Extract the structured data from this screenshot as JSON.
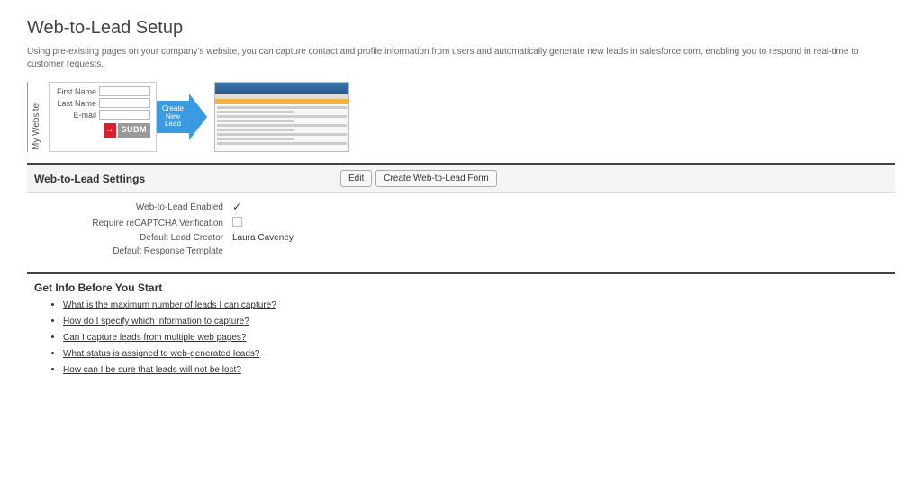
{
  "page": {
    "title": "Web-to-Lead Setup",
    "description": "Using pre-existing pages on your company's website, you can capture contact and profile information from users and automatically generate new leads in salesforce.com, enabling you to respond in real-time to customer requests."
  },
  "illustration": {
    "sidelabel": "My Website",
    "fields": {
      "firstname": "First Name",
      "lastname": "Last Name",
      "email": "E-mail"
    },
    "submit": "SUBM",
    "arrow_label": "Create New Lead"
  },
  "settings": {
    "header": "Web-to-Lead Settings",
    "buttons": {
      "edit": "Edit",
      "createform": "Create Web-to-Lead Form"
    },
    "rows": {
      "enabled": {
        "label": "Web-to-Lead Enabled",
        "checked": true
      },
      "recaptcha": {
        "label": "Require reCAPTCHA Verification",
        "checked": false
      },
      "creator": {
        "label": "Default Lead Creator",
        "value": "Laura Caveney"
      },
      "template": {
        "label": "Default Response Template",
        "value": ""
      }
    }
  },
  "info": {
    "header": "Get Info Before You Start",
    "links": [
      "What is the maximum number of leads I can capture?",
      "How do I specify which information to capture?",
      "Can I capture leads from multiple web pages?",
      "What status is assigned to web-generated leads?",
      "How can I be sure that leads will not be lost?"
    ]
  }
}
